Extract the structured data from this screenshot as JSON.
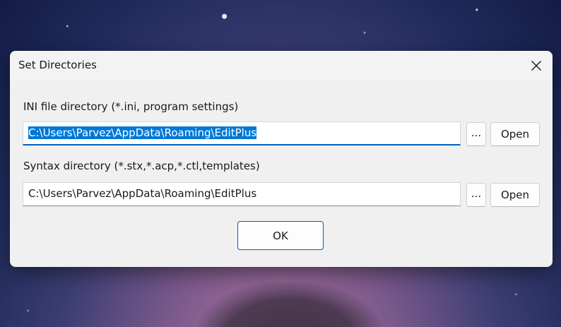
{
  "dialog": {
    "title": "Set Directories",
    "close_icon": "close-icon"
  },
  "ini": {
    "label": "INI file directory (*.ini, program settings)",
    "value": "C:\\Users\\Parvez\\AppData\\Roaming\\EditPlus",
    "browse_label": "...",
    "open_label": "Open"
  },
  "syntax": {
    "label": "Syntax directory (*.stx,*.acp,*.ctl,templates)",
    "value": "C:\\Users\\Parvez\\AppData\\Roaming\\EditPlus",
    "browse_label": "...",
    "open_label": "Open"
  },
  "ok_label": "OK",
  "colors": {
    "accent": "#005fb8",
    "selection": "#0078d7",
    "dialog_bg": "#f0f0f0"
  }
}
